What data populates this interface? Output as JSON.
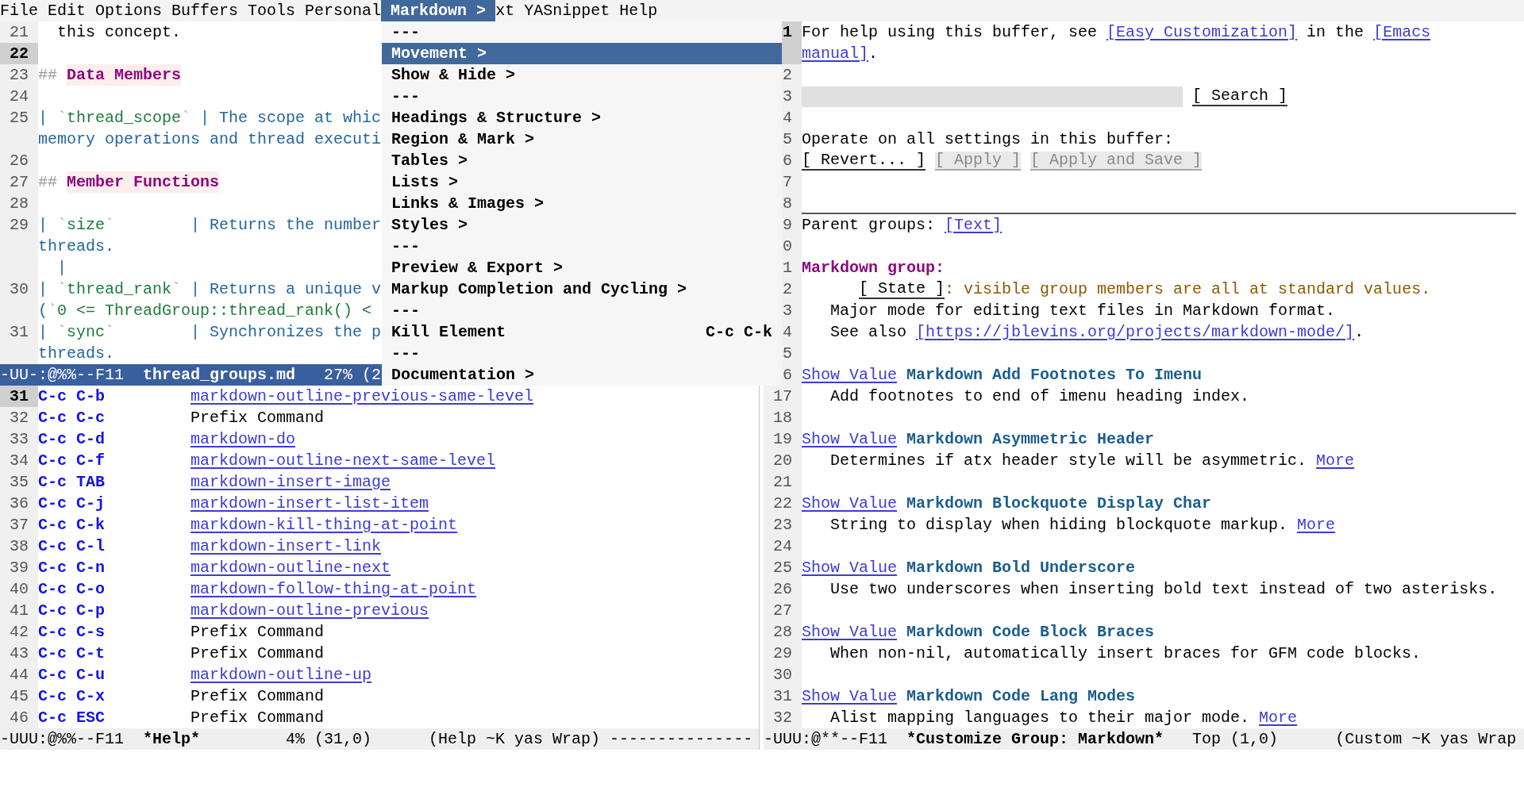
{
  "menu_bar": [
    {
      "label": "File",
      "selected": false
    },
    {
      "label": "Edit",
      "selected": false
    },
    {
      "label": "Options",
      "selected": false
    },
    {
      "label": "Buffers",
      "selected": false
    },
    {
      "label": "Tools",
      "selected": false
    },
    {
      "label": "Personal",
      "selected": false
    },
    {
      "label": "Markdown >",
      "selected": true
    },
    {
      "label": "xt",
      "selected": false
    },
    {
      "label": "YASnippet",
      "selected": false
    },
    {
      "label": "Help",
      "selected": false
    }
  ],
  "menu": {
    "items": [
      {
        "label": "---",
        "selected": false
      },
      {
        "label": "Movement >",
        "selected": true
      },
      {
        "label": "Show & Hide >",
        "selected": false
      },
      {
        "label": "---",
        "selected": false
      },
      {
        "label": "Headings & Structure >",
        "selected": false
      },
      {
        "label": "Region & Mark >",
        "selected": false
      },
      {
        "label": "Tables >",
        "selected": false
      },
      {
        "label": "Lists >",
        "selected": false
      },
      {
        "label": "Links & Images >",
        "selected": false
      },
      {
        "label": "Styles >",
        "selected": false
      },
      {
        "label": "---",
        "selected": false
      },
      {
        "label": "Preview & Export >",
        "selected": false
      },
      {
        "label": "Markup Completion and Cycling >",
        "selected": false
      },
      {
        "label": "---",
        "selected": false
      },
      {
        "label": "Kill Element",
        "shortcut": "C-c C-k",
        "selected": false
      },
      {
        "label": "---",
        "selected": false
      },
      {
        "label": "Documentation >",
        "selected": false
      }
    ]
  },
  "editor_window": {
    "lines": [
      {
        "number": "21",
        "current": false,
        "rows": [
          {
            "segments": [
              {
                "kind": "text",
                "text": "  this concept."
              }
            ]
          }
        ]
      },
      {
        "number": "22",
        "current": true
      },
      {
        "number": "23",
        "current": false,
        "rows": [
          {
            "segments": [
              {
                "kind": "markup",
                "text": "## "
              },
              {
                "kind": "heading",
                "text": "Data Members"
              }
            ]
          }
        ]
      },
      {
        "number": "24",
        "current": false
      },
      {
        "number": "25",
        "current": false,
        "rows": [
          {
            "segments": [
              {
                "kind": "table",
                "text": "| "
              },
              {
                "kind": "markup",
                "text": "`"
              },
              {
                "kind": "code",
                "text": "thread_scope"
              },
              {
                "kind": "markup",
                "text": "`"
              },
              {
                "kind": "table",
                "text": " | The scope at whic"
              }
            ]
          },
          {
            "segments": [
              {
                "kind": "table",
                "text": "memory operations and thread executi"
              }
            ]
          }
        ]
      },
      {
        "number": "26",
        "current": false
      },
      {
        "number": "27",
        "current": false,
        "rows": [
          {
            "segments": [
              {
                "kind": "markup",
                "text": "## "
              },
              {
                "kind": "heading",
                "text": "Member Functions"
              }
            ]
          }
        ]
      },
      {
        "number": "28",
        "current": false
      },
      {
        "number": "29",
        "current": false,
        "rows": [
          {
            "segments": [
              {
                "kind": "table",
                "text": "| "
              },
              {
                "kind": "markup",
                "text": "`"
              },
              {
                "kind": "code",
                "text": "size"
              },
              {
                "kind": "markup",
                "text": "`"
              },
              {
                "kind": "table",
                "text": "        | Returns the number"
              }
            ]
          },
          {
            "segments": [
              {
                "kind": "table",
                "text": "threads."
              }
            ]
          },
          {
            "segments": [
              {
                "kind": "table",
                "text": "  |"
              }
            ]
          }
        ]
      },
      {
        "number": "30",
        "current": false,
        "rows": [
          {
            "segments": [
              {
                "kind": "table",
                "text": "| "
              },
              {
                "kind": "markup",
                "text": "`"
              },
              {
                "kind": "code",
                "text": "thread_rank"
              },
              {
                "kind": "markup",
                "text": "`"
              },
              {
                "kind": "table",
                "text": " | Returns a unique v"
              }
            ]
          },
          {
            "segments": [
              {
                "kind": "table",
                "text": "("
              },
              {
                "kind": "markup",
                "text": "`"
              },
              {
                "kind": "code",
                "text": "0 <= ThreadGroup::thread_rank() <"
              }
            ]
          }
        ]
      },
      {
        "number": "31",
        "current": false,
        "rows": [
          {
            "segments": [
              {
                "kind": "table",
                "text": "| "
              },
              {
                "kind": "markup",
                "text": "`"
              },
              {
                "kind": "code",
                "text": "sync"
              },
              {
                "kind": "markup",
                "text": "`"
              },
              {
                "kind": "table",
                "text": "        | Synchronizes the p"
              }
            ]
          },
          {
            "segments": [
              {
                "kind": "table",
                "text": "threads."
              }
            ]
          }
        ]
      }
    ],
    "mode_line": {
      "active": true,
      "flags": "-UU-:@%%--F11",
      "buffer": "thread_groups.md",
      "position": "27% (2"
    }
  },
  "help_window": {
    "rows": [
      {
        "number": "31",
        "current": true,
        "key": "C-c C-b",
        "command": "markdown-outline-previous-same-level",
        "link": true
      },
      {
        "number": "32",
        "current": false,
        "key": "C-c C-c",
        "command": "Prefix Command",
        "link": false
      },
      {
        "number": "33",
        "current": false,
        "key": "C-c C-d",
        "command": "markdown-do",
        "link": true
      },
      {
        "number": "34",
        "current": false,
        "key": "C-c C-f",
        "command": "markdown-outline-next-same-level",
        "link": true
      },
      {
        "number": "35",
        "current": false,
        "key": "C-c TAB",
        "command": "markdown-insert-image",
        "link": true
      },
      {
        "number": "36",
        "current": false,
        "key": "C-c C-j",
        "command": "markdown-insert-list-item",
        "link": true
      },
      {
        "number": "37",
        "current": false,
        "key": "C-c C-k",
        "command": "markdown-kill-thing-at-point",
        "link": true
      },
      {
        "number": "38",
        "current": false,
        "key": "C-c C-l",
        "command": "markdown-insert-link",
        "link": true
      },
      {
        "number": "39",
        "current": false,
        "key": "C-c C-n",
        "command": "markdown-outline-next",
        "link": true
      },
      {
        "number": "40",
        "current": false,
        "key": "C-c C-o",
        "command": "markdown-follow-thing-at-point",
        "link": true
      },
      {
        "number": "41",
        "current": false,
        "key": "C-c C-p",
        "command": "markdown-outline-previous",
        "link": true
      },
      {
        "number": "42",
        "current": false,
        "key": "C-c C-s",
        "command": "Prefix Command",
        "link": false
      },
      {
        "number": "43",
        "current": false,
        "key": "C-c C-t",
        "command": "Prefix Command",
        "link": false
      },
      {
        "number": "44",
        "current": false,
        "key": "C-c C-u",
        "command": "markdown-outline-up",
        "link": true
      },
      {
        "number": "45",
        "current": false,
        "key": "C-c C-x",
        "command": "Prefix Command",
        "link": false
      },
      {
        "number": "46",
        "current": false,
        "key": "C-c ESC",
        "command": "Prefix Command",
        "link": false
      }
    ],
    "mode_line": {
      "active": false,
      "flags": "-UUU:@%%--F11",
      "buffer": "*Help*",
      "position": "4% (31,0)",
      "modes": "(Help ~K yas Wrap) ---------------"
    }
  },
  "customize_window": {
    "lines": [
      {
        "number": "1",
        "current": true,
        "kind": "para",
        "rows": [
          {
            "segments": [
              {
                "kind": "text",
                "text": "For help using this buffer, see "
              },
              {
                "kind": "link",
                "text": "[Easy Customization]"
              },
              {
                "kind": "text",
                "text": " in the "
              },
              {
                "kind": "link",
                "text": "[Emacs"
              }
            ]
          },
          {
            "segments": [
              {
                "kind": "link",
                "text": "manual]"
              },
              {
                "kind": "text",
                "text": "."
              }
            ]
          }
        ]
      },
      {
        "number": "2",
        "current": false,
        "kind": "blank"
      },
      {
        "number": "3",
        "current": false,
        "kind": "fields",
        "rows": [
          {
            "segments": [
              {
                "kind": "field"
              },
              {
                "kind": "button",
                "text": "[ Search ]",
                "disabled": false
              }
            ]
          }
        ]
      },
      {
        "number": "4",
        "current": false,
        "kind": "blank"
      },
      {
        "number": "5",
        "current": false,
        "kind": "para",
        "rows": [
          {
            "segments": [
              {
                "kind": "text",
                "text": "Operate on all settings in this buffer:"
              }
            ]
          }
        ]
      },
      {
        "number": "6",
        "current": false,
        "kind": "fields",
        "rows": [
          {
            "segments": [
              {
                "kind": "button",
                "text": "[ Revert... ]",
                "disabled": false
              },
              {
                "kind": "button",
                "text": "[ Apply ]",
                "disabled": true
              },
              {
                "kind": "button",
                "text": "[ Apply and Save ]",
                "disabled": true
              }
            ]
          }
        ]
      },
      {
        "number": "7",
        "current": false,
        "kind": "blank"
      },
      {
        "number": "8",
        "current": false,
        "kind": "rule"
      },
      {
        "number": "9",
        "current": false,
        "kind": "para",
        "rows": [
          {
            "segments": [
              {
                "kind": "text",
                "text": "Parent groups: "
              },
              {
                "kind": "link",
                "text": "[Text]"
              }
            ]
          }
        ]
      },
      {
        "number": "0",
        "current": false,
        "kind": "blank"
      },
      {
        "number": "1",
        "current": false,
        "kind": "fields",
        "rows": [
          {
            "segments": [
              {
                "kind": "group",
                "text": "Markdown group:"
              }
            ]
          }
        ]
      },
      {
        "number": "2",
        "current": false,
        "kind": "state",
        "rows": [
          {
            "segments": [
              {
                "kind": "button",
                "text": "[ State ]",
                "disabled": false
              },
              {
                "kind": "note",
                "text": ": visible group members are all at standard values."
              }
            ]
          }
        ]
      },
      {
        "number": "3",
        "current": false,
        "kind": "aside",
        "rows": [
          {
            "segments": [
              {
                "kind": "text",
                "text": "Major mode for editing text files in Markdown format."
              }
            ]
          }
        ]
      },
      {
        "number": "4",
        "current": false,
        "kind": "aside",
        "rows": [
          {
            "segments": [
              {
                "kind": "text",
                "text": "See also "
              },
              {
                "kind": "link",
                "text": "[https://jblevins.org/projects/markdown-mode/]"
              },
              {
                "kind": "text",
                "text": "."
              }
            ]
          }
        ]
      },
      {
        "number": "5",
        "current": false,
        "kind": "blank"
      },
      {
        "number": "6",
        "current": false,
        "kind": "fields",
        "rows": [
          {
            "segments": [
              {
                "kind": "link",
                "text": "Show Value"
              },
              {
                "kind": "name",
                "text": "Markdown Add Footnotes To Imenu"
              }
            ]
          }
        ]
      },
      {
        "number": "17",
        "current": false,
        "kind": "doc",
        "rows": [
          {
            "segments": [
              {
                "kind": "text",
                "text": "Add footnotes to end of imenu heading index."
              }
            ]
          }
        ]
      },
      {
        "number": "18",
        "current": false,
        "kind": "blank"
      },
      {
        "number": "19",
        "current": false,
        "kind": "fields",
        "rows": [
          {
            "segments": [
              {
                "kind": "link",
                "text": "Show Value"
              },
              {
                "kind": "name",
                "text": "Markdown Asymmetric Header"
              }
            ]
          }
        ]
      },
      {
        "number": "20",
        "current": false,
        "kind": "doc",
        "rows": [
          {
            "segments": [
              {
                "kind": "text",
                "text": "Determines if atx header style will be asymmetric."
              },
              {
                "kind": "link",
                "text": "More"
              }
            ]
          }
        ]
      },
      {
        "number": "21",
        "current": false,
        "kind": "blank"
      },
      {
        "number": "22",
        "current": false,
        "kind": "fields",
        "rows": [
          {
            "segments": [
              {
                "kind": "link",
                "text": "Show Value"
              },
              {
                "kind": "name",
                "text": "Markdown Blockquote Display Char"
              }
            ]
          }
        ]
      },
      {
        "number": "23",
        "current": false,
        "kind": "doc",
        "rows": [
          {
            "segments": [
              {
                "kind": "text",
                "text": "String to display when hiding blockquote markup."
              },
              {
                "kind": "link",
                "text": "More"
              }
            ]
          }
        ]
      },
      {
        "number": "24",
        "current": false,
        "kind": "blank"
      },
      {
        "number": "25",
        "current": false,
        "kind": "fields",
        "rows": [
          {
            "segments": [
              {
                "kind": "link",
                "text": "Show Value"
              },
              {
                "kind": "name",
                "text": "Markdown Bold Underscore"
              }
            ]
          }
        ]
      },
      {
        "number": "26",
        "current": false,
        "kind": "doc",
        "rows": [
          {
            "segments": [
              {
                "kind": "text",
                "text": "Use two underscores when inserting bold text instead of two asterisks."
              }
            ]
          }
        ]
      },
      {
        "number": "27",
        "current": false,
        "kind": "blank"
      },
      {
        "number": "28",
        "current": false,
        "kind": "fields",
        "rows": [
          {
            "segments": [
              {
                "kind": "link",
                "text": "Show Value"
              },
              {
                "kind": "name",
                "text": "Markdown Code Block Braces"
              }
            ]
          }
        ]
      },
      {
        "number": "29",
        "current": false,
        "kind": "doc",
        "rows": [
          {
            "segments": [
              {
                "kind": "text",
                "text": "When non-nil, automatically insert braces for GFM code blocks."
              }
            ]
          }
        ]
      },
      {
        "number": "30",
        "current": false,
        "kind": "blank"
      },
      {
        "number": "31",
        "current": false,
        "kind": "fields",
        "rows": [
          {
            "segments": [
              {
                "kind": "link",
                "text": "Show Value"
              },
              {
                "kind": "name",
                "text": "Markdown Code Lang Modes"
              }
            ]
          }
        ]
      },
      {
        "number": "32",
        "current": false,
        "kind": "doc",
        "rows": [
          {
            "segments": [
              {
                "kind": "text",
                "text": "Alist mapping languages to their major mode."
              },
              {
                "kind": "link",
                "text": "More"
              }
            ]
          }
        ]
      }
    ],
    "mode_line": {
      "active": false,
      "flags": "-UUU:@**--F11",
      "buffer": "*Customize Group: Markdown*",
      "position": "Top (1,0)",
      "modes": "(Custom ~K yas Wrap"
    }
  }
}
